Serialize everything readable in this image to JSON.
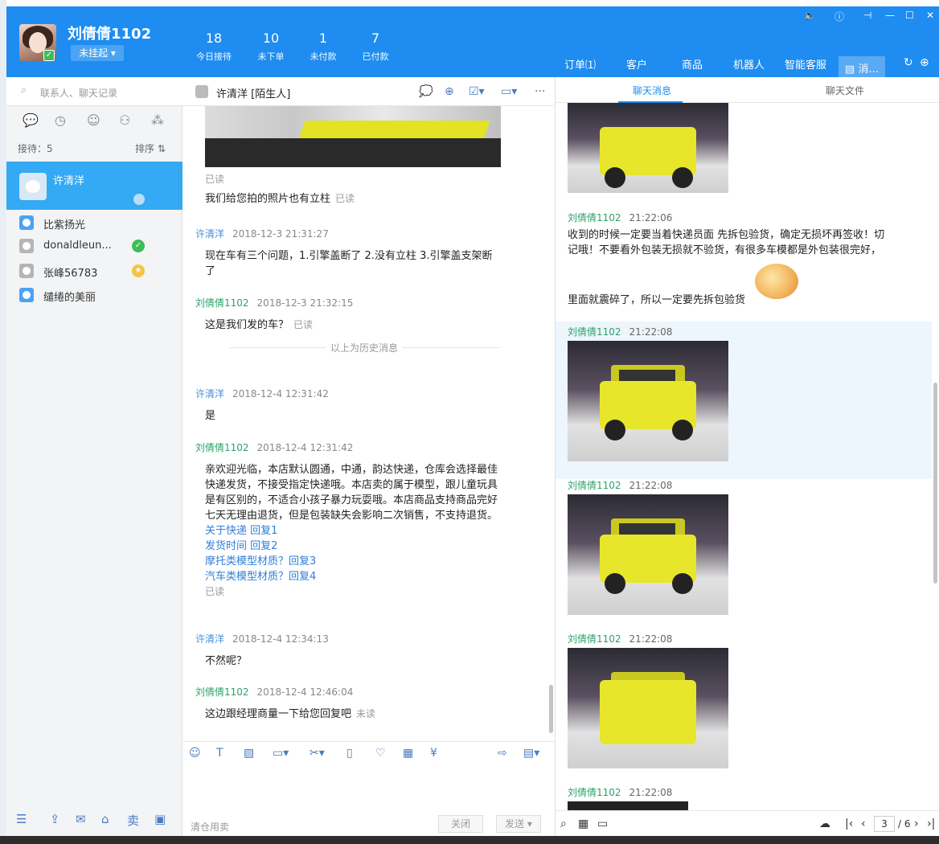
{
  "header": {
    "user_name": "刘倩倩1102",
    "status": "未挂起",
    "stats": [
      {
        "num": "18",
        "label": "今日接待"
      },
      {
        "num": "10",
        "label": "未下单"
      },
      {
        "num": "1",
        "label": "未付款"
      },
      {
        "num": "7",
        "label": "已付款"
      }
    ],
    "tabs": [
      {
        "label": "订单⑴"
      },
      {
        "label": "客户"
      },
      {
        "label": "商品"
      },
      {
        "label": "机器人"
      },
      {
        "label": "智能客服"
      },
      {
        "label": "消..."
      }
    ]
  },
  "sidebar": {
    "search_placeholder": "联系人、聊天记录",
    "receive_label": "接待：5",
    "sort_label": "排序 ⇅",
    "active_contact": "许清洋",
    "contacts": [
      {
        "name": "比紫扬光"
      },
      {
        "name": "donaldleun..."
      },
      {
        "name": "张峰56783"
      },
      {
        "name": "缱绻的美丽"
      }
    ]
  },
  "chat": {
    "contact_name": "许清洋",
    "contact_tag": "[陌生人]",
    "read_top": "已读",
    "msg1_text": "我们给您拍的照片也有立柱",
    "msg1_read": "已读",
    "msg2_who": "许清洋",
    "msg2_time": "2018-12-3 21:31:27",
    "msg2_text": "现在车有三个问题，1.引擎盖断了 2.没有立柱 3.引擎盖支架断了",
    "msg3_who": "刘倩倩1102",
    "msg3_time": "2018-12-3 21:32:15",
    "msg3_text": "这是我们发的车？",
    "msg3_read": "已读",
    "divider": "以上为历史消息",
    "msg4_who": "许清洋",
    "msg4_time": "2018-12-4 12:31:42",
    "msg4_text": "是",
    "msg5_who": "刘倩倩1102",
    "msg5_time": "2018-12-4 12:31:42",
    "msg5_text": "亲欢迎光临，本店默认圆通，中通，韵达快递，仓库会选择最佳快递发货，不接受指定快递哦。本店卖的属于模型，跟儿童玩具是有区别的，不适合小孩子暴力玩耍哦。本店商品支持商品完好七天无理由退货，但是包装缺失会影响二次销售，不支持退货。",
    "msg5_links": [
      "关于快递 回复1",
      "发货时间 回复2",
      "摩托类模型材质？回复3",
      "汽车类模型材质？回复4"
    ],
    "msg5_read": "已读",
    "msg6_who": "许清洋",
    "msg6_time": "2018-12-4 12:34:13",
    "msg6_text": "不然呢？",
    "msg7_who": "刘倩倩1102",
    "msg7_time": "2018-12-4 12:46:04",
    "msg7_text": "这边跟经理商量一下给您回复吧",
    "msg7_read": "未读",
    "phrase": "清仓用卖",
    "close_btn": "关闭",
    "send_btn": "发送"
  },
  "right": {
    "tab_messages": "聊天消息",
    "tab_files": "聊天文件",
    "rm1_who": "刘倩倩1102",
    "rm1_time": "21:22:06",
    "rm1_text1": "收到的时候一定要当着快递员面 先拆包验货，确定无损坏再签收！切记哦！不要看外包装无损就不验货，有很多车模都是外包装很完好，",
    "rm1_text2": "里面就震碎了，所以一定要先拆包验货",
    "rm_who": "刘倩倩1102",
    "rm_time": "21:22:08",
    "page_current": "3",
    "page_total": "/ 6"
  }
}
